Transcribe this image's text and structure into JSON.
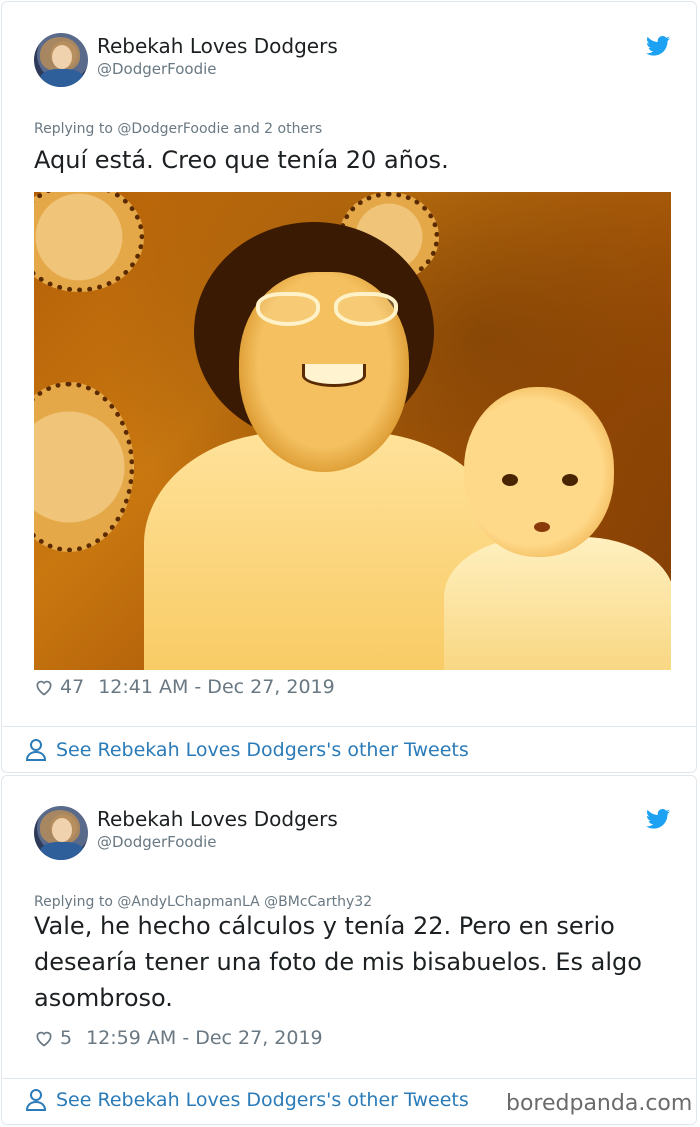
{
  "tweets": [
    {
      "user": {
        "name": "Rebekah Loves Dodgers",
        "handle": "@DodgerFoodie"
      },
      "replying_to": "Replying to @DodgerFoodie and 2 others",
      "text": "Aquí está. Creo que tenía 20 años.",
      "likes": "47",
      "timestamp": "12:41 AM - Dec 27, 2019",
      "see_more": "See Rebekah Loves Dodgers's other Tweets"
    },
    {
      "user": {
        "name": "Rebekah Loves Dodgers",
        "handle": "@DodgerFoodie"
      },
      "replying_to": "Replying to @AndyLChapmanLA @BMcCarthy32",
      "text_lines": [
        "Vale, he hecho cálculos y tenía 22. Pero en serio",
        "desearía tener una foto de mis bisabuelos. Es algo",
        "asombroso."
      ],
      "likes": "5",
      "timestamp": "12:59 AM - Dec 27, 2019",
      "see_more": "See Rebekah Loves Dodgers's other Tweets"
    }
  ],
  "watermark": "boredpanda.com",
  "colors": {
    "link": "#2b7bb9",
    "muted": "#697882",
    "twitter_blue": "#1da1f2"
  },
  "icons": [
    "twitter-bird-icon",
    "heart-icon",
    "person-icon"
  ]
}
